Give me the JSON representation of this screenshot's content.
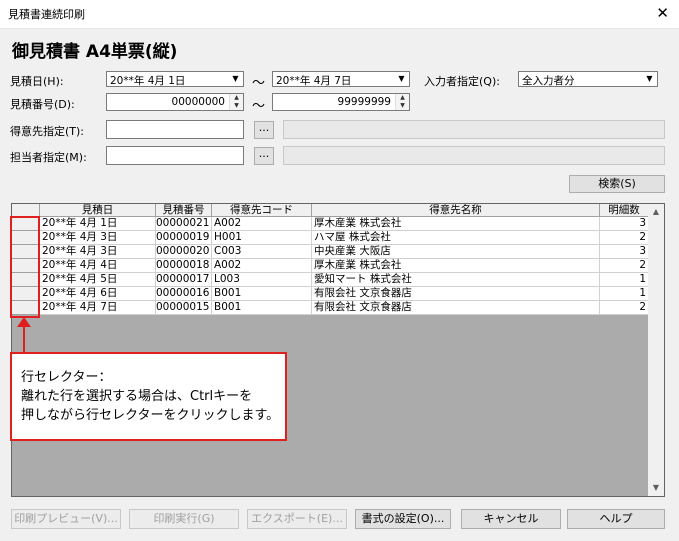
{
  "window": {
    "title": "見積書連続印刷",
    "close": "✕"
  },
  "heading": "御見積書 A4単票(縦)",
  "form": {
    "date_label": "見積日(H):",
    "date_from": "20**年  4月  1日",
    "date_to": "20**年  4月  7日",
    "tilde": "〜",
    "input_label": "入力者指定(Q):",
    "input_value": "全入力者分",
    "num_label": "見積番号(D):",
    "num_from": "00000000",
    "num_to": "99999999",
    "cust_label": "得意先指定(T):",
    "staff_label": "担当者指定(M):",
    "browse": "...",
    "search_button": "検索(S)"
  },
  "table": {
    "headers": [
      "見積日",
      "見積番号",
      "得意先コード",
      "得意先名称",
      "明細数"
    ],
    "rows": [
      [
        "20**年  4月  1日",
        "00000021",
        "A002",
        "厚木産業  株式会社",
        "3"
      ],
      [
        "20**年  4月  3日",
        "00000019",
        "H001",
        "ハマ屋  株式会社",
        "2"
      ],
      [
        "20**年  4月  3日",
        "00000020",
        "C003",
        "中央産業  大阪店",
        "3"
      ],
      [
        "20**年  4月  4日",
        "00000018",
        "A002",
        "厚木産業  株式会社",
        "2"
      ],
      [
        "20**年  4月  5日",
        "00000017",
        "L003",
        "愛知マート  株式会社",
        "1"
      ],
      [
        "20**年  4月  6日",
        "00000016",
        "B001",
        "有限会社  文京食器店",
        "1"
      ],
      [
        "20**年  4月  7日",
        "00000015",
        "B001",
        "有限会社  文京食器店",
        "2"
      ]
    ]
  },
  "callout": {
    "line1": "行セレクター：",
    "line2": "離れた行を選択する場合は、Ctrlキーを",
    "line3": "押しながら行セレクターをクリックします。"
  },
  "buttons": {
    "preview": "印刷プレビュー(V)...",
    "print": "印刷実行(G)",
    "export": "エクスポート(E)...",
    "format": "書式の設定(O)...",
    "cancel": "キャンセル",
    "help": "ヘルプ"
  },
  "colors": {
    "annotation": "#e0201e"
  }
}
